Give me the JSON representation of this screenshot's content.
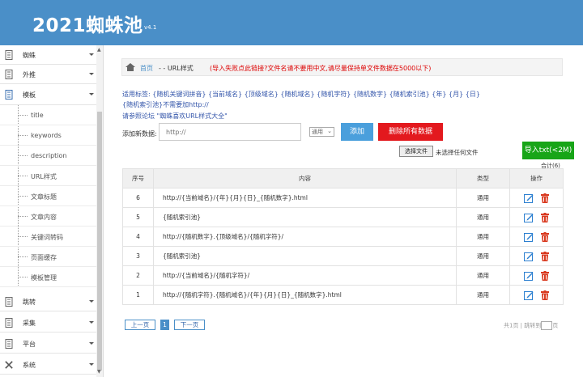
{
  "header": {
    "logo": "2021蜘蛛池",
    "version": "v4.1"
  },
  "sidebar": {
    "top_items": [
      {
        "label": "蜘蛛",
        "icon": "document-icon"
      },
      {
        "label": "外推",
        "icon": "document-icon"
      },
      {
        "label": "模板",
        "icon": "document-icon",
        "active": true
      }
    ],
    "sub_items": [
      "title",
      "keywords",
      "description",
      "URL样式",
      "文章标题",
      "文章内容",
      "关键词转码",
      "页面缓存",
      "模板管理"
    ],
    "bottom_items": [
      {
        "label": "跳转",
        "icon": "document-icon"
      },
      {
        "label": "采集",
        "icon": "document-icon"
      },
      {
        "label": "平台",
        "icon": "document-icon"
      },
      {
        "label": "系统",
        "icon": "wrench-icon"
      }
    ]
  },
  "breadcrumb": {
    "home": "首页",
    "current": "- - URL样式",
    "note": "(导入失败点此链接?文件名请不要用中文,请尽量保持单文件数据在5000以下)"
  },
  "hints": {
    "tags_line1": "适用标签: {随机关键词拼音} {当前域名} {顶级域名} {随机域名} {随机字符} {随机数字} {随机索引池} {年} {月} {日}",
    "tags_line2": "{随机索引池}不需要加http://",
    "tags_line3": "请参照论坛 \"蜘蛛喜欢URL样式大全\""
  },
  "add_form": {
    "label": "添加新数据:",
    "placeholder": "http://",
    "select_value": "通用",
    "add_button": "添加",
    "delete_all_button": "删除所有数据",
    "file_button": "选择文件",
    "file_status": "未选择任何文件",
    "import_button": "导入txt(<2M)",
    "total": "合计(6)"
  },
  "table": {
    "headers": [
      "序号",
      "内容",
      "类型",
      "操作"
    ],
    "rows": [
      {
        "no": "6",
        "content": "http://{当前域名}/{年}{月}{日}_{随机数字}.html",
        "type": "通用"
      },
      {
        "no": "5",
        "content": "{随机索引池}",
        "type": "通用"
      },
      {
        "no": "4",
        "content": "http://{随机数字}.{顶级域名}/{随机字符}/",
        "type": "通用"
      },
      {
        "no": "3",
        "content": "{随机索引池}",
        "type": "通用"
      },
      {
        "no": "2",
        "content": "http://{当前域名}/{随机字符}/",
        "type": "通用"
      },
      {
        "no": "1",
        "content": "http://{随机字符}.{随机域名}/{年}{月}{日}_{随机数字}.html",
        "type": "通用"
      }
    ]
  },
  "pagination": {
    "prev": "上一页",
    "current": "1",
    "next": "下一页",
    "info_left": "共1页 | 跳转到",
    "info_right": "页"
  },
  "colors": {
    "header": "#4a8fc8",
    "add": "#4a9fdc",
    "delete": "#e3191e",
    "import": "#18a518",
    "edit_icon": "#2b7fd0",
    "trash_icon": "#d9391f"
  }
}
